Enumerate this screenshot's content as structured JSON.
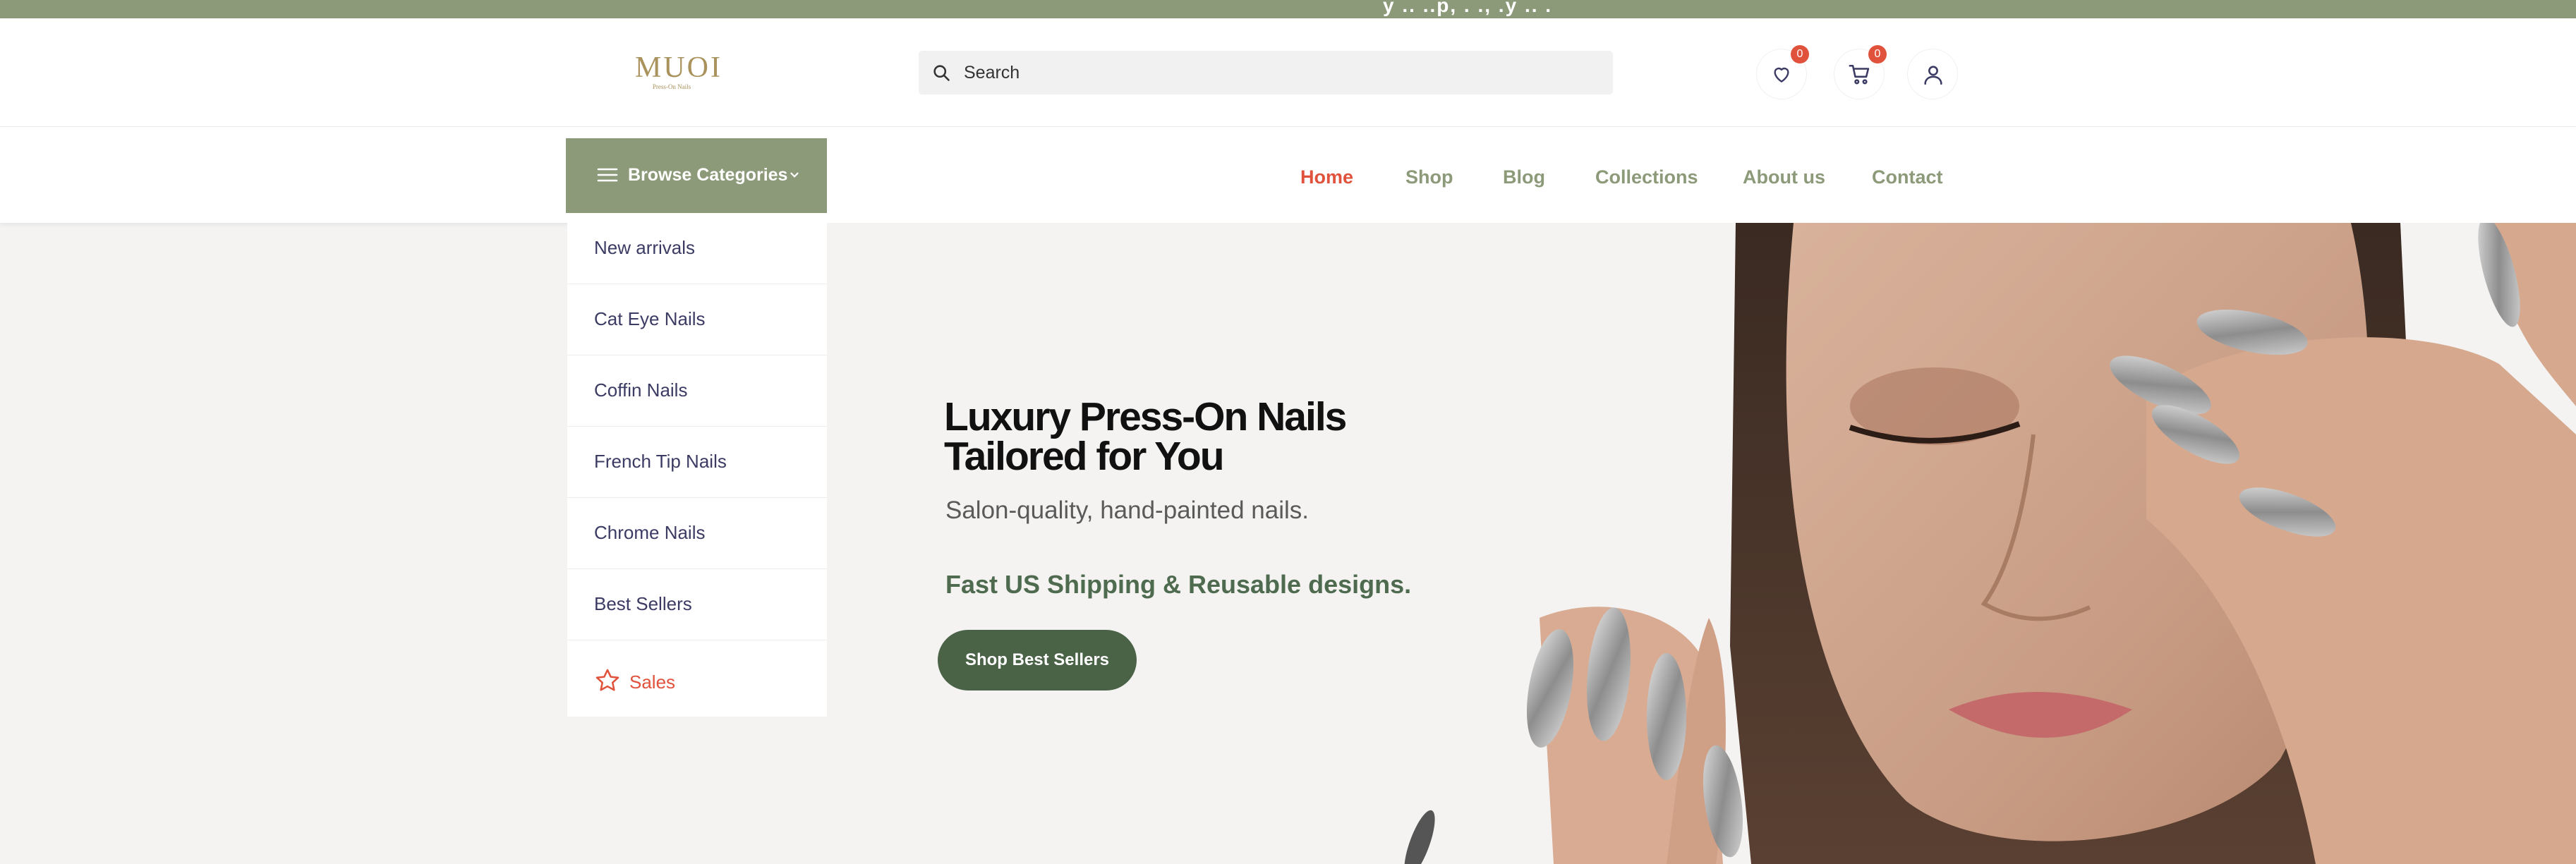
{
  "topbar": {
    "text": "y .. ..p, .  ., .y .. ."
  },
  "brand": {
    "logo_text": "MUOI",
    "logo_tagline": "Press-On Nails"
  },
  "search": {
    "placeholder": "Search"
  },
  "header_icons": {
    "wishlist_count": "0",
    "cart_count": "0"
  },
  "browse": {
    "label": "Browse Categories"
  },
  "nav": {
    "items": [
      {
        "label": "Home",
        "active": true
      },
      {
        "label": "Shop"
      },
      {
        "label": "Blog"
      },
      {
        "label": "Collections"
      },
      {
        "label": "About us"
      },
      {
        "label": "Contact"
      }
    ]
  },
  "categories": [
    {
      "label": "New arrivals"
    },
    {
      "label": "Cat Eye Nails"
    },
    {
      "label": "Coffin Nails"
    },
    {
      "label": "French Tip Nails"
    },
    {
      "label": "Chrome Nails"
    },
    {
      "label": "Best Sellers"
    },
    {
      "label": "Sales",
      "icon": "star-icon"
    }
  ],
  "hero": {
    "title_line1": "Luxury Press-On Nails",
    "title_line2": "Tailored for You",
    "subtitle": "Salon-quality, hand-painted nails.",
    "shipping": "Fast US Shipping & Reusable designs.",
    "cta": "Shop Best Sellers"
  },
  "colors": {
    "sage": "#8c9a7a",
    "accent_red": "#e0523b",
    "dark_green": "#4a6347",
    "category_text": "#3b3b64"
  }
}
